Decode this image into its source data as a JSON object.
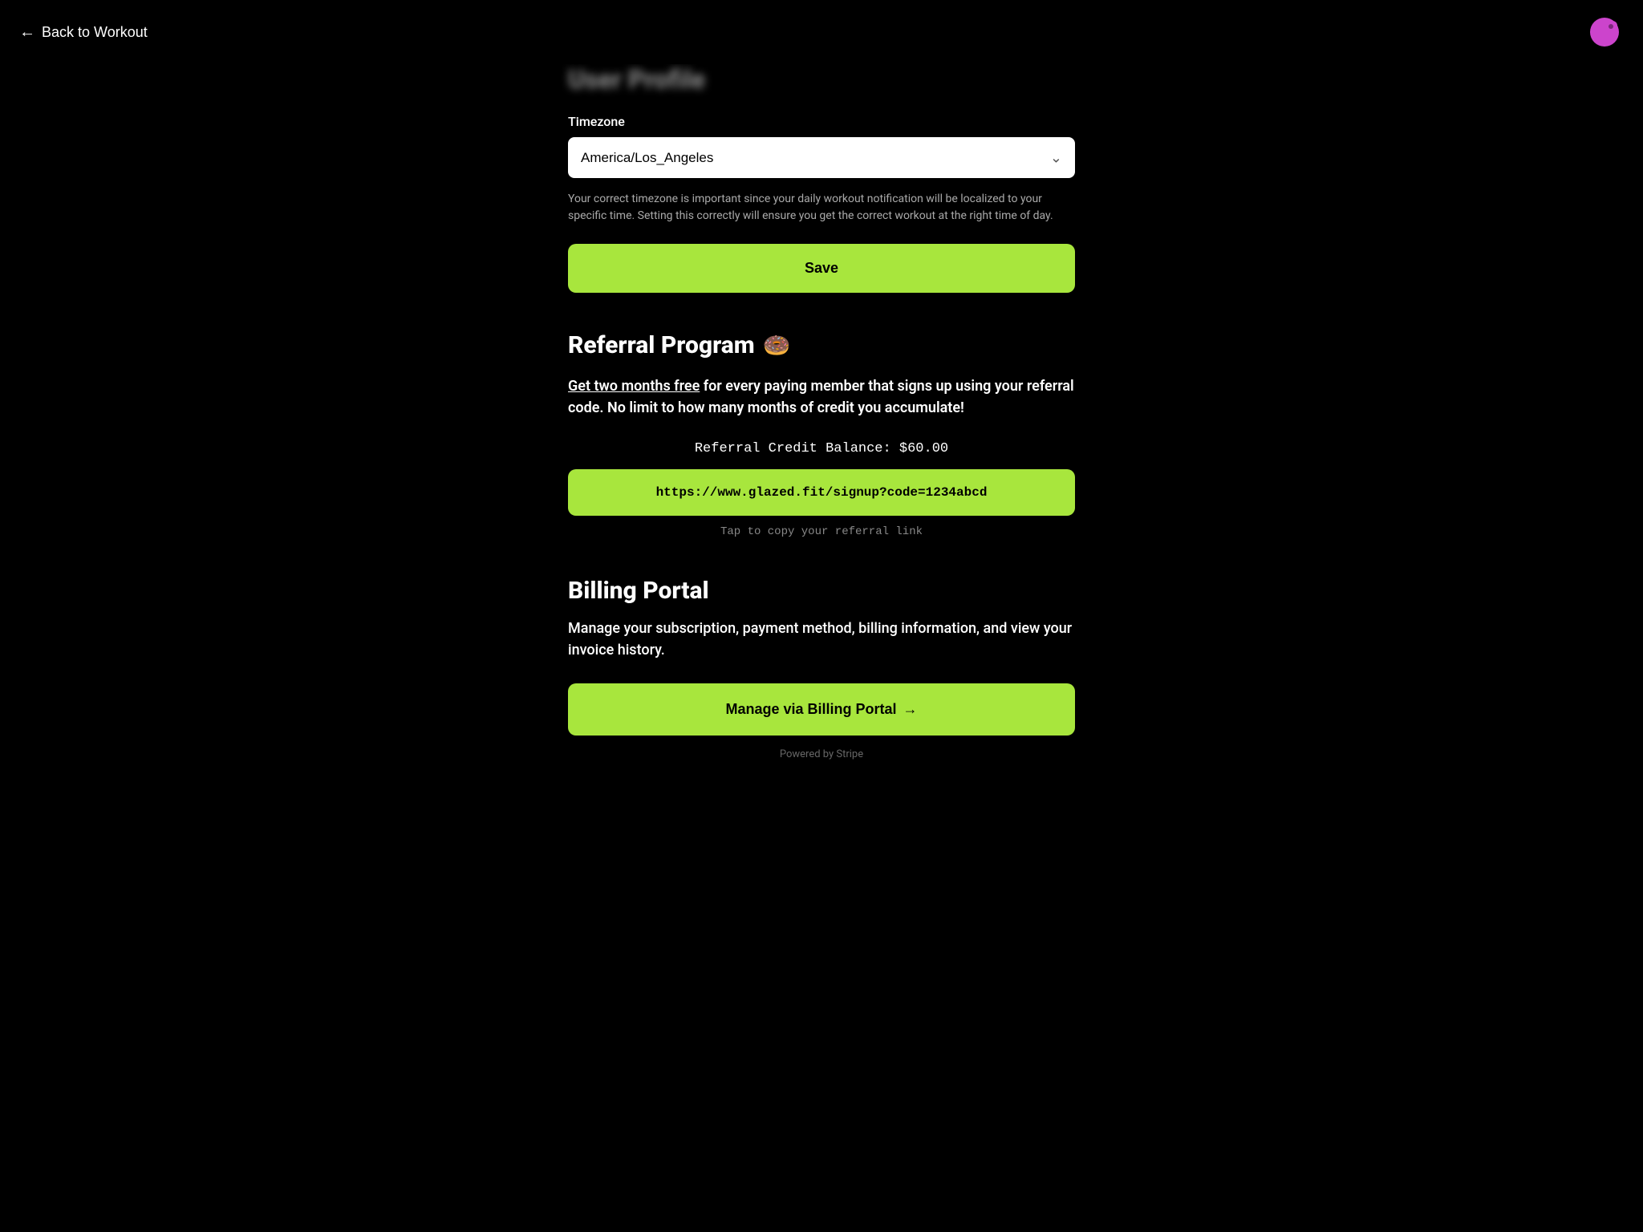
{
  "nav": {
    "back_label": "Back to Workout",
    "back_arrow": "←"
  },
  "user_profile": {
    "title": "User Profile",
    "timezone": {
      "label": "Timezone",
      "value": "America/Los_Angeles",
      "description": "Your correct timezone is important since your daily workout notification will be localized to your specific time. Setting this correctly will ensure you get the correct workout at the right time of day."
    },
    "save_label": "Save"
  },
  "referral": {
    "title": "Referral Program",
    "emoji": "🍩",
    "link_text": "Get two months free",
    "description_rest": " for every paying member that signs up using your referral code. No limit to how many months of credit you accumulate!",
    "balance_label": "Referral Credit Balance: $60.00",
    "referral_url": "https://www.glazed.fit/signup?code=1234abcd",
    "copy_hint": "Tap to copy your referral link"
  },
  "billing": {
    "title": "Billing Portal",
    "description": "Manage your subscription, payment method, billing information, and view your invoice history.",
    "portal_button_label": "Manage via Billing Portal",
    "portal_button_arrow": "→",
    "powered_by": "Powered by Stripe"
  },
  "colors": {
    "accent": "#a8e63d",
    "logo": "#cc44cc"
  }
}
